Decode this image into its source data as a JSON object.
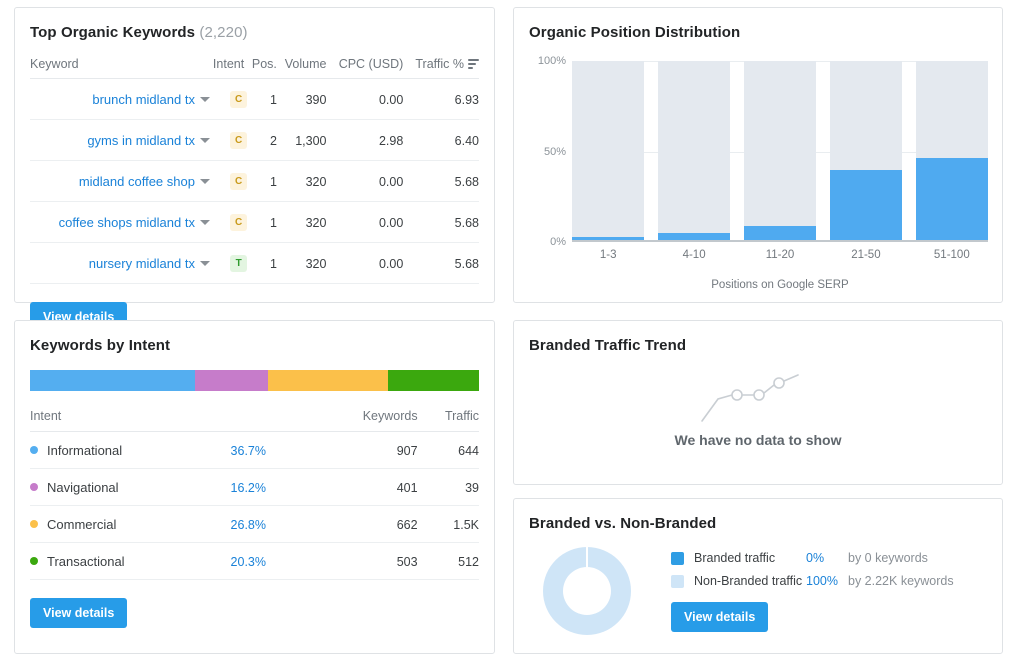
{
  "top_organic_keywords": {
    "title": "Top Organic Keywords",
    "count": "(2,220)",
    "columns": {
      "keyword": "Keyword",
      "intent": "Intent",
      "position": "Pos.",
      "volume": "Volume",
      "cpc": "CPC (USD)",
      "traffic_pct": "Traffic %"
    },
    "sort_icon": "sort-descending-icon",
    "rows": [
      {
        "keyword": "brunch midland tx",
        "intent": "C",
        "intent_class": "c",
        "position": "1",
        "volume": "390",
        "cpc": "0.00",
        "traffic_pct": "6.93"
      },
      {
        "keyword": "gyms in midland tx",
        "intent": "C",
        "intent_class": "c",
        "position": "2",
        "volume": "1,300",
        "cpc": "2.98",
        "traffic_pct": "6.40"
      },
      {
        "keyword": "midland coffee shop",
        "intent": "C",
        "intent_class": "c",
        "position": "1",
        "volume": "320",
        "cpc": "0.00",
        "traffic_pct": "5.68"
      },
      {
        "keyword": "coffee shops midland tx",
        "intent": "C",
        "intent_class": "c",
        "position": "1",
        "volume": "320",
        "cpc": "0.00",
        "traffic_pct": "5.68"
      },
      {
        "keyword": "nursery midland tx",
        "intent": "T",
        "intent_class": "t",
        "position": "1",
        "volume": "320",
        "cpc": "0.00",
        "traffic_pct": "5.68"
      }
    ],
    "view_details_label": "View details"
  },
  "organic_position_distribution": {
    "title": "Organic Position Distribution"
  },
  "keywords_by_intent": {
    "title": "Keywords by Intent",
    "columns": {
      "intent": "Intent",
      "keywords": "Keywords",
      "traffic": "Traffic"
    },
    "rows": [
      {
        "name": "Informational",
        "pct": "36.7%",
        "keywords": "907",
        "traffic": "644",
        "color": "#54aef0"
      },
      {
        "name": "Navigational",
        "pct": "16.2%",
        "keywords": "401",
        "traffic": "39",
        "color": "#c67cca"
      },
      {
        "name": "Commercial",
        "pct": "26.8%",
        "keywords": "662",
        "traffic": "1.5K",
        "color": "#fbc04a"
      },
      {
        "name": "Transactional",
        "pct": "20.3%",
        "keywords": "503",
        "traffic": "512",
        "color": "#3ba80e"
      }
    ],
    "view_details_label": "View details"
  },
  "branded_traffic_trend": {
    "title": "Branded Traffic Trend",
    "empty_message": "We have no data to show",
    "empty_icon": "line-chart-icon"
  },
  "branded_vs_non_branded": {
    "title": "Branded vs. Non-Branded",
    "legend": [
      {
        "name": "Branded traffic",
        "pct": "0%",
        "by": "by 0 keywords",
        "color": "#2f9de4"
      },
      {
        "name": "Non-Branded traffic",
        "pct": "100%",
        "by": "by 2.22K keywords",
        "color": "#cfe5f7"
      }
    ],
    "view_details_label": "View details"
  },
  "chart_data": [
    {
      "type": "bar",
      "name": "organic-position-distribution",
      "title": "Organic Position Distribution",
      "categories": [
        "1-3",
        "4-10",
        "11-20",
        "21-50",
        "51-100"
      ],
      "values": [
        1.5,
        4.0,
        8.0,
        39.0,
        46.0
      ],
      "track_value": 100,
      "xlabel": "Positions on Google SERP",
      "ylabel": "",
      "ylim": [
        0,
        100
      ],
      "yticks": [
        "0%",
        "50%",
        "100%"
      ],
      "ytick_values": [
        0,
        50,
        100
      ],
      "grid": true,
      "legend": "none",
      "bar_color": "#4faaf0",
      "track_color": "#e4e9ef"
    },
    {
      "type": "bar",
      "name": "keywords-by-intent-stacked",
      "title": "Keywords by Intent",
      "orientation": "horizontal-stacked",
      "categories": [
        "Informational",
        "Navigational",
        "Commercial",
        "Transactional"
      ],
      "values": [
        36.7,
        16.2,
        26.8,
        20.3
      ],
      "counts": [
        907,
        401,
        662,
        503
      ],
      "traffic": [
        "644",
        "39",
        "1.5K",
        "512"
      ],
      "colors": [
        "#54aef0",
        "#c67cca",
        "#fbc04a",
        "#3ba80e"
      ],
      "ylim": [
        0,
        100
      ],
      "grid": false,
      "legend": "below-as-table"
    },
    {
      "type": "pie",
      "name": "branded-vs-non-branded-donut",
      "title": "Branded vs. Non-Branded",
      "categories": [
        "Branded traffic",
        "Non-Branded traffic"
      ],
      "values": [
        0,
        100
      ],
      "colors": [
        "#2f9de4",
        "#cfe5f7"
      ],
      "hole": 0.55,
      "legend": "right"
    },
    {
      "type": "line",
      "name": "branded-traffic-trend",
      "title": "Branded Traffic Trend",
      "x": [],
      "values": [],
      "empty": true,
      "empty_message": "We have no data to show"
    }
  ]
}
